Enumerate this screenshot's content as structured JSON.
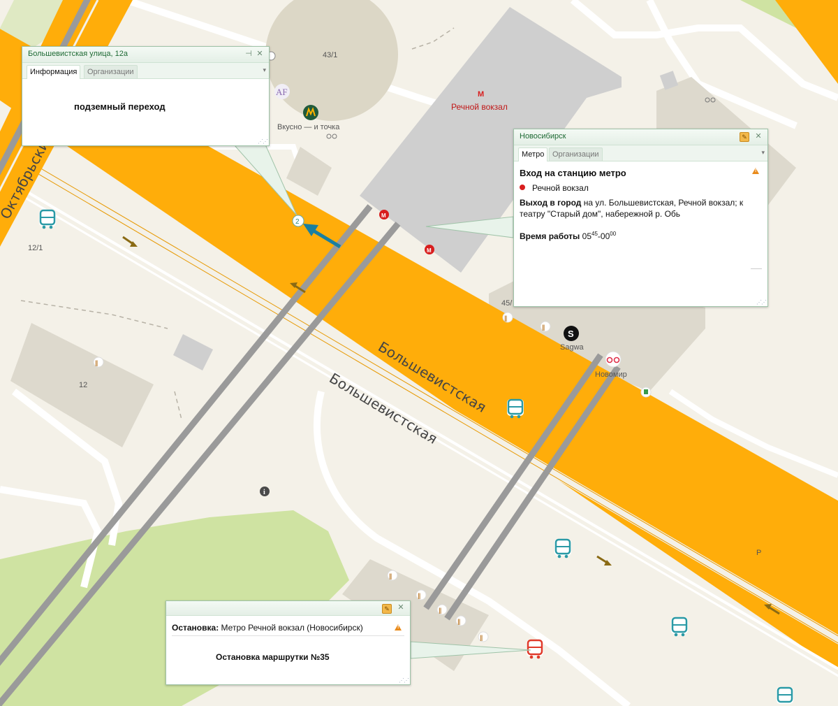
{
  "map": {
    "labels": {
      "building_43_1": "43/1",
      "building_12_1": "12/1",
      "building_12": "12",
      "building_45": "45/",
      "parking": "P",
      "metro_station": "Речной вокзал",
      "metro_letter": "М",
      "vkusno": "Вкусно — и точка",
      "af_logo": "AF",
      "sagwa": "Sagwa",
      "novomir": "Новомир",
      "street_bolsh_1": "Большевистская",
      "street_bolsh_2": "Большевистская",
      "street_oktyabr": "Октябрьский мост",
      "underpass_number": "2",
      "info_letter": "i"
    },
    "colors": {
      "road": "#ffad0a",
      "road_edge": "#e79a05",
      "background": "#f4f1e8",
      "building": "#d9d6cc",
      "metro_building": "#cfcfcf",
      "rail": "#9a9a9a",
      "green": "#cfe3a2",
      "bus_icon": "#2a9aa6",
      "bus_icon_active": "#e03a2a",
      "metro_red": "#d81e1e",
      "arrow_blue": "#1a7fa0"
    }
  },
  "popups": {
    "underpass": {
      "title": "Большевистская улица, 12а",
      "tabs": [
        "Информация",
        "Организации"
      ],
      "text": "подземный переход",
      "pin_icon": "pin-icon",
      "close_icon": "close-icon"
    },
    "metro": {
      "title": "Новосибирск",
      "tabs": [
        "Метро",
        "Организации"
      ],
      "heading": "Вход на станцию метро",
      "station": "Речной вокзал",
      "exit_bold": "Выход в город",
      "exit_text": " на ул. Большевистская, Речной вокзал; к театру \"Старый дом\", набережной р. Обь",
      "hours_bold": "Время работы",
      "hours_open": "05",
      "hours_open_sup": "45",
      "hours_sep": "-00",
      "hours_close_sup": "00"
    },
    "stop": {
      "label_bold": "Остановка:",
      "label_text": " Метро Речной вокзал (Новосибирск)",
      "text": "Остановка маршрутки №35"
    }
  }
}
